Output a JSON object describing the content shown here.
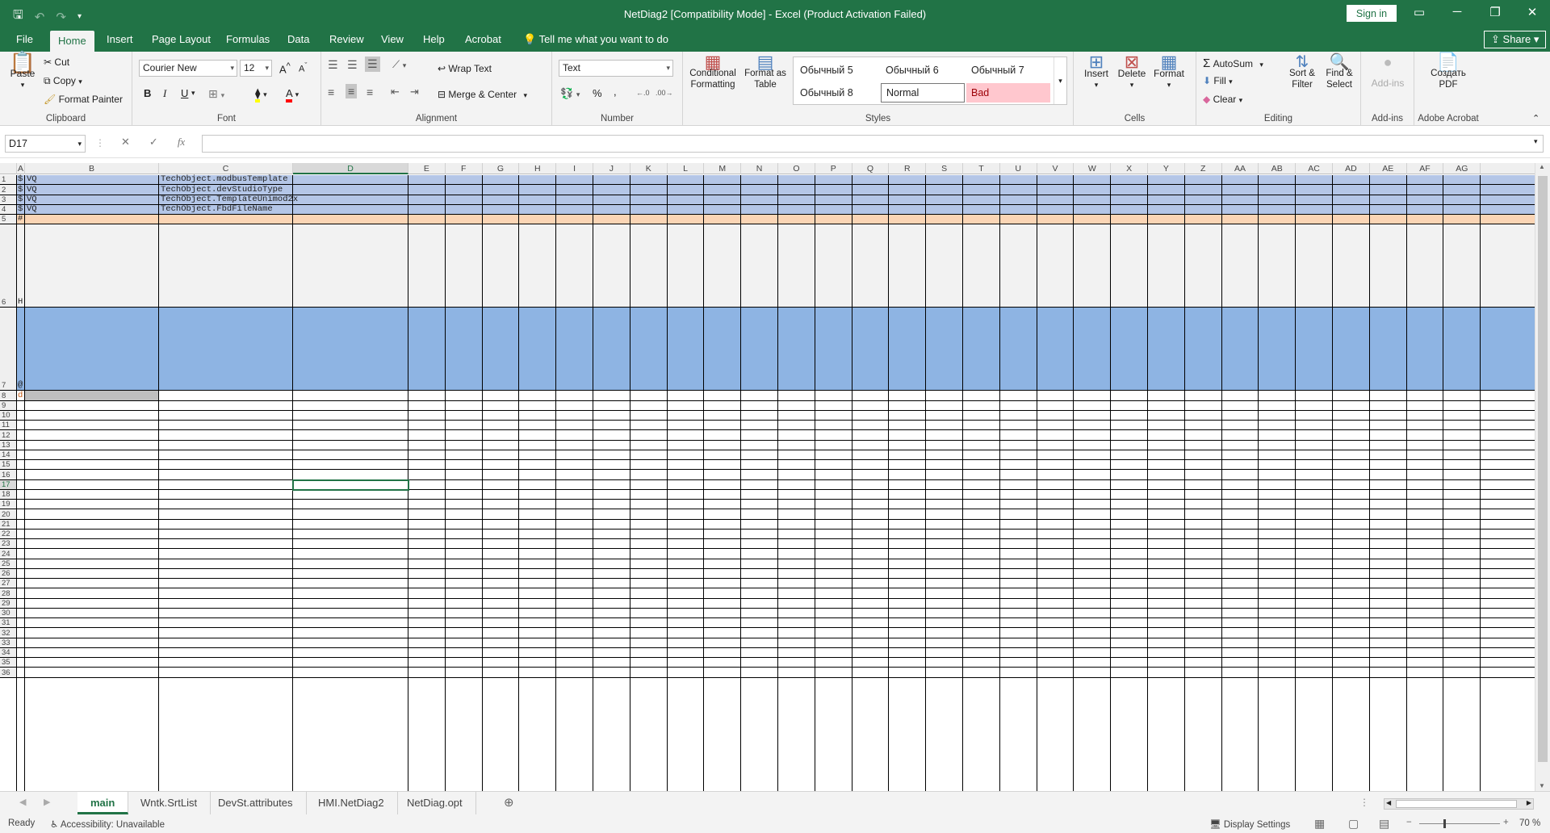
{
  "window": {
    "title": "NetDiag2  [Compatibility Mode]  -  Excel (Product Activation Failed)",
    "sign_in": "Sign in",
    "share": "Share"
  },
  "tabs": [
    "File",
    "Home",
    "Insert",
    "Page Layout",
    "Formulas",
    "Data",
    "Review",
    "View",
    "Help",
    "Acrobat"
  ],
  "active_tab": "Home",
  "tell_me": "Tell me what you want to do",
  "ribbon": {
    "clipboard": {
      "label": "Clipboard",
      "paste": "Paste",
      "cut": "Cut",
      "copy": "Copy",
      "format_painter": "Format Painter"
    },
    "font": {
      "label": "Font",
      "family": "Courier New",
      "size": "12",
      "bold": "B",
      "italic": "I",
      "underline": "U"
    },
    "alignment": {
      "label": "Alignment",
      "wrap": "Wrap Text",
      "merge": "Merge & Center"
    },
    "number": {
      "label": "Number",
      "format": "Text",
      "percent": "%",
      "comma": ","
    },
    "styles": {
      "label": "Styles",
      "cond_fmt": "Conditional Formatting",
      "fmt_table": "Format as Table",
      "items": [
        "Обычный 5",
        "Обычный 6",
        "Обычный 7",
        "Обычный 8",
        "Normal",
        "Bad"
      ]
    },
    "cells": {
      "label": "Cells",
      "insert": "Insert",
      "delete": "Delete",
      "format": "Format"
    },
    "editing": {
      "label": "Editing",
      "autosum": "AutoSum",
      "fill": "Fill",
      "clear": "Clear",
      "sort": "Sort & Filter",
      "find": "Find & Select"
    },
    "addins": {
      "label": "Add-ins",
      "button": "Add-ins"
    },
    "acrobat": {
      "label": "Adobe Acrobat",
      "button": "Создать PDF"
    }
  },
  "formula_bar": {
    "name_box": "D17",
    "fx": "fx",
    "value": ""
  },
  "columns": [
    "A",
    "B",
    "C",
    "D",
    "E",
    "F",
    "G",
    "H",
    "I",
    "J",
    "K",
    "L",
    "M",
    "N",
    "O",
    "P",
    "Q",
    "R",
    "S",
    "T",
    "U",
    "V",
    "W",
    "X",
    "Y",
    "Z",
    "AA",
    "AB",
    "AC",
    "AD",
    "AE",
    "AF",
    "AG"
  ],
  "selected_column": "D",
  "selected_row": "17",
  "row_markers": {
    "1": "$",
    "2": "$",
    "3": "$",
    "4": "$",
    "5": "#",
    "6": "H",
    "7": "@",
    "8": "d"
  },
  "cells": {
    "B1": "VQ",
    "B2": "VQ",
    "B3": "VQ",
    "B4": "VQ",
    "C1": "TechObject.modbusTemplate",
    "C2": "TechObject.devStudioType",
    "C3": "TechObject.TemplateUnimod2x",
    "C4": "TechObject.FbdFileName"
  },
  "colors": {
    "excel_green": "#217346",
    "row_blue": "#b4c6e7",
    "row_orange": "#fbd5b5",
    "row_big_blue": "#8eb4e3",
    "row_grey": "#f2f2f2",
    "cell_grey": "#bfbfbf"
  },
  "sheets": [
    "main",
    "Wntk.SrtList",
    "DevSt.attributes",
    "HMI.NetDiag2",
    "NetDiag.opt"
  ],
  "active_sheet": "main",
  "status": {
    "ready": "Ready",
    "accessibility": "Accessibility: Unavailable",
    "display": "Display Settings",
    "zoom": "70 %"
  }
}
